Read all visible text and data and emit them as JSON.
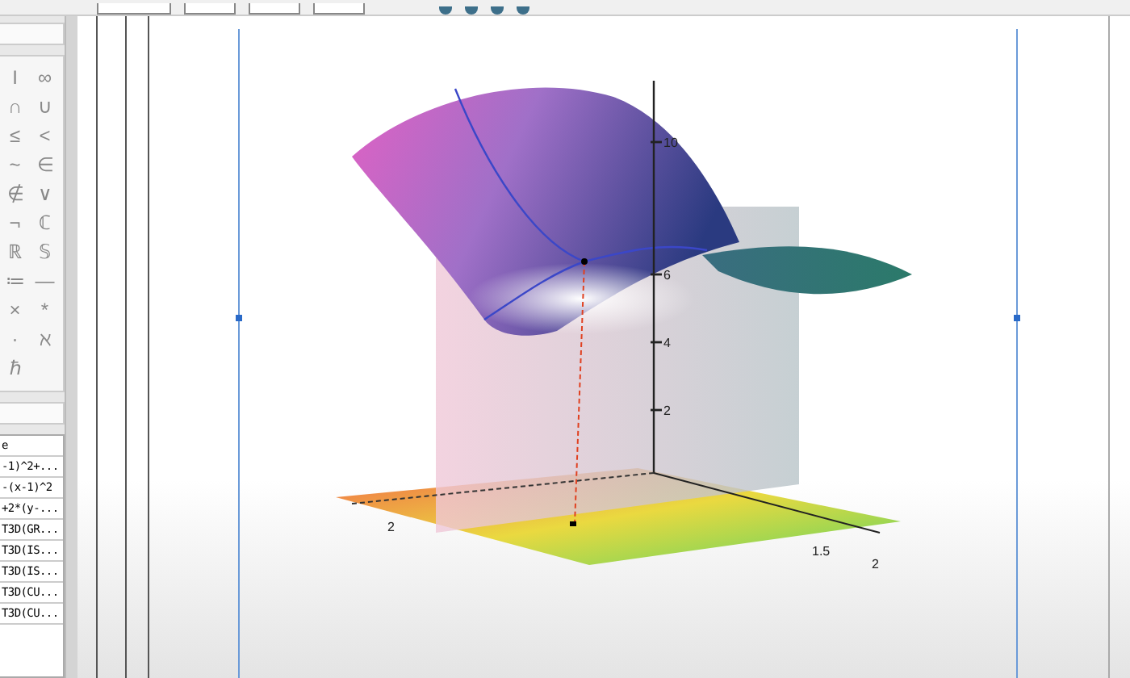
{
  "palette": {
    "symbols": [
      "I",
      "∞",
      "∩",
      "∪",
      "≤",
      "<",
      "~",
      "∈",
      "∉",
      "∨",
      "¬",
      "ℂ",
      "ℝ",
      "𝕊",
      "≔",
      "—",
      "×",
      "*",
      "·",
      "ℵ",
      "ℏ"
    ]
  },
  "variables": {
    "header": "e",
    "entries": [
      "-1)^2+...",
      "-(x-1)^2",
      "+2*(y-...",
      "T3D(GR...",
      "T3D(IS...",
      "T3D(IS...",
      "T3D(CU...",
      "T3D(CU..."
    ]
  },
  "plot": {
    "z_ticks": [
      "10",
      "6",
      "4",
      "2"
    ],
    "x_tick": "2",
    "y_ticks": [
      "1.5",
      "2"
    ]
  }
}
